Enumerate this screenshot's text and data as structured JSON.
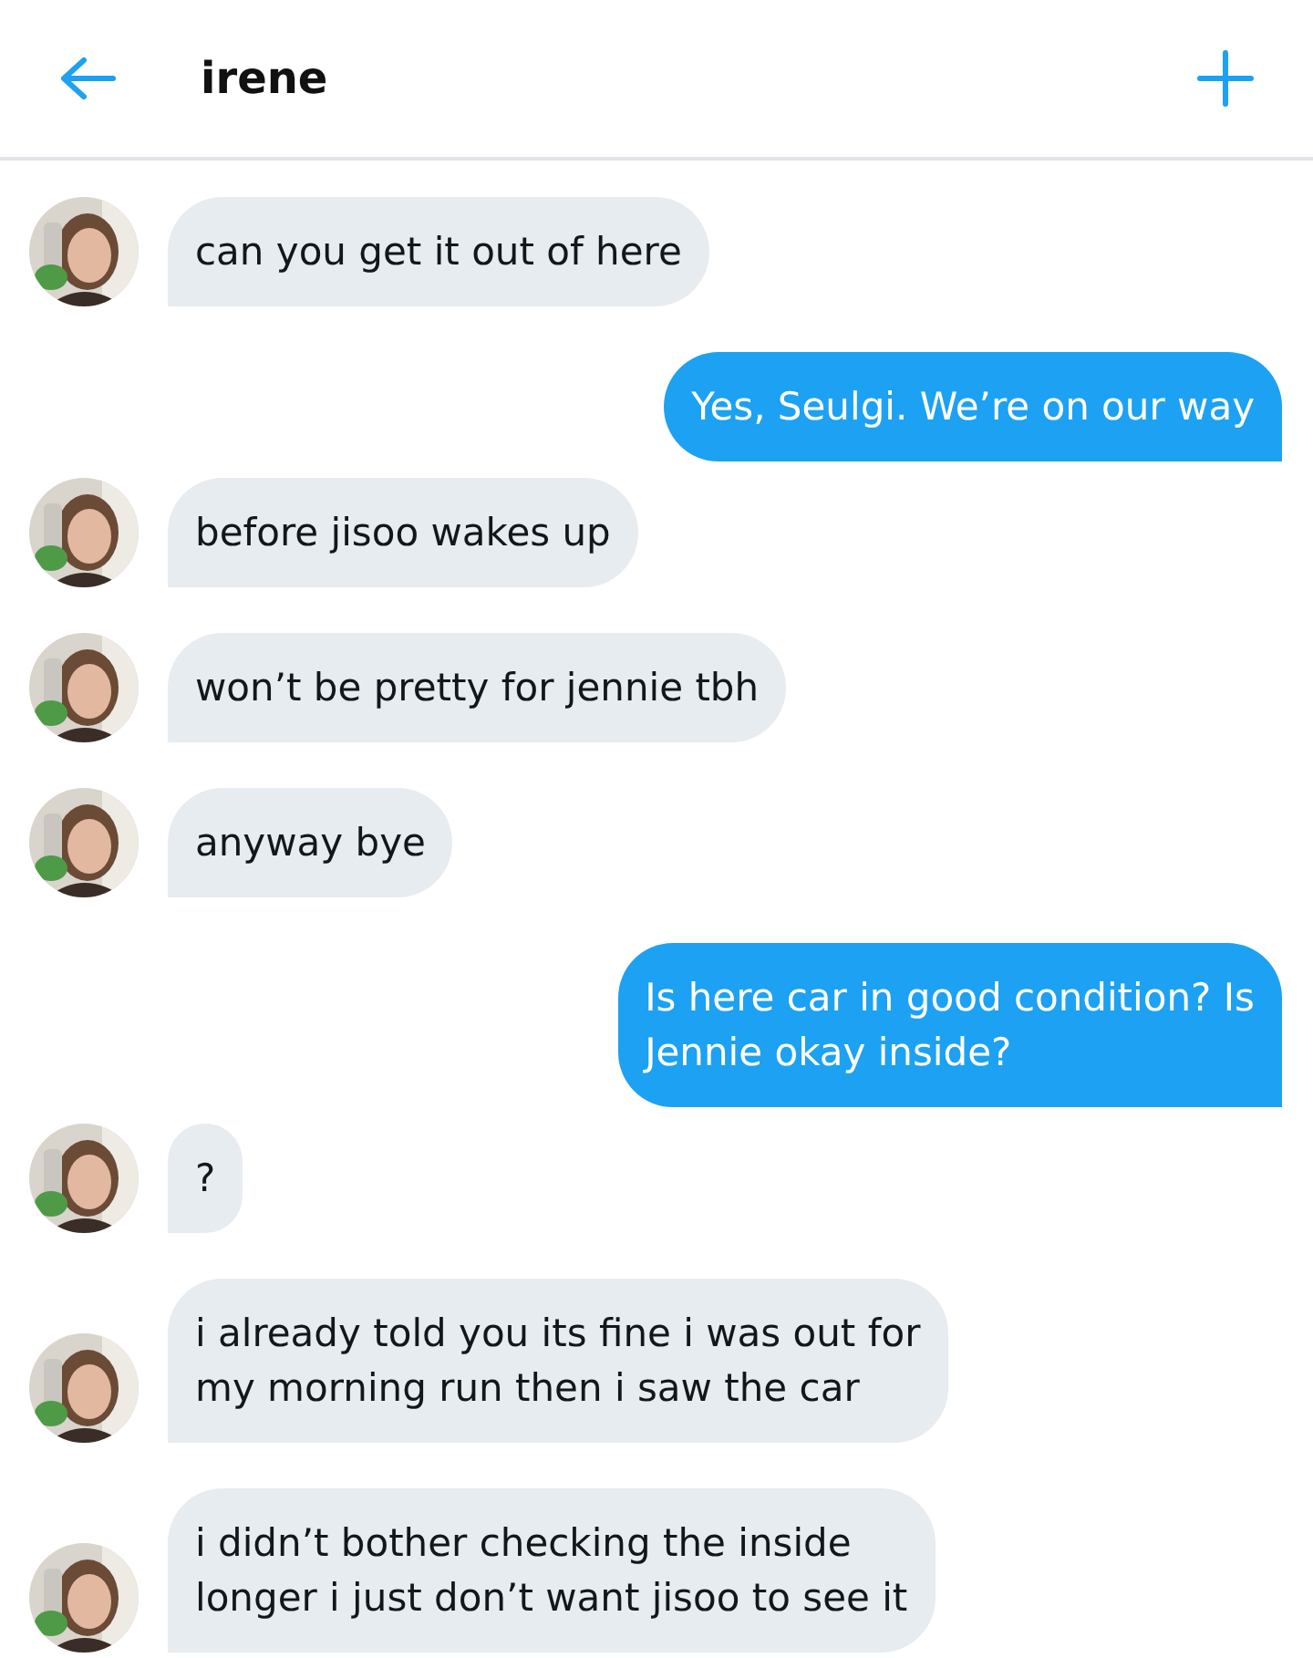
{
  "header": {
    "title": "irene"
  },
  "messages": [
    {
      "kind": "received",
      "text": "can you get it out of here"
    },
    {
      "kind": "sent",
      "text": "Yes, Seulgi. We’re on our way"
    },
    {
      "kind": "received",
      "text": "before jisoo wakes up"
    },
    {
      "kind": "received",
      "text": "won’t be pretty for jennie tbh"
    },
    {
      "kind": "received",
      "text": "anyway bye"
    },
    {
      "kind": "sent",
      "text": "Is here car in good condition? Is\nJennie okay inside?"
    },
    {
      "kind": "received",
      "text": "?"
    },
    {
      "kind": "received",
      "text": "i already told you its fine i was out for\nmy morning run then i saw the car"
    },
    {
      "kind": "received",
      "text": "i didn’t bother checking the inside\nlonger i just don’t want jisoo to see it"
    }
  ]
}
